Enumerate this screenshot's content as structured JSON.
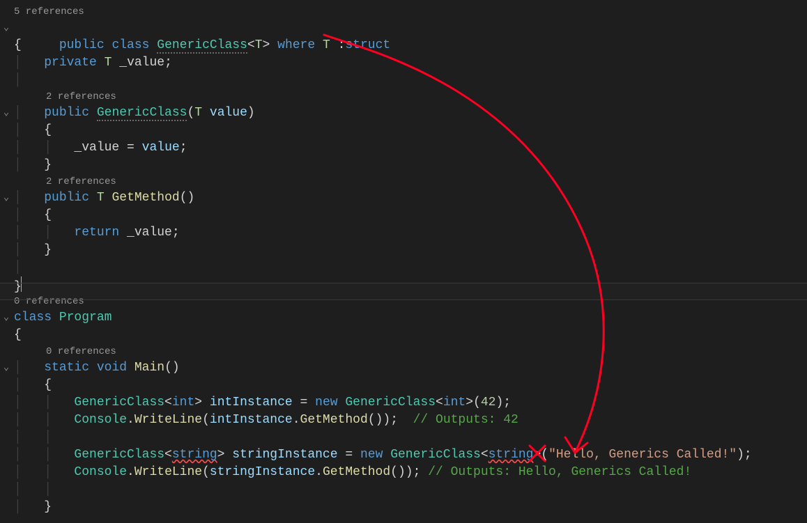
{
  "codelens": {
    "ref5": "5 references",
    "ref2a": "2 references",
    "ref2b": "2 references",
    "ref0a": "0 references",
    "ref0b": "0 references"
  },
  "kw": {
    "public": "public",
    "class": "class",
    "where": "where",
    "struct": "struct",
    "private": "private",
    "return": "return",
    "static": "static",
    "void": "void",
    "new": "new",
    "int": "int",
    "string": "string"
  },
  "type": {
    "GenericClass": "GenericClass",
    "Console": "Console",
    "T": "T"
  },
  "method": {
    "GetMethod": "GetMethod",
    "Main": "Main",
    "WriteLine": "WriteLine"
  },
  "ident": {
    "value_param": "value",
    "intInstance": "intInstance",
    "stringInstance": "stringInstance",
    "Program": "Program"
  },
  "field": {
    "_value": "_value"
  },
  "literal": {
    "n42": "42",
    "hello": "\"Hello, Generics Called!\""
  },
  "comment": {
    "out42": "// Outputs: 42",
    "outHello": "// Outputs: Hello, Generics Called!"
  },
  "punct": {
    "open_brace": "{",
    "close_brace": "}",
    "open_paren": "(",
    "close_paren": ")",
    "open_angle": "<",
    "close_angle": ">",
    "semicolon": ";",
    "dot": ".",
    "eq": "=",
    "colon": ":",
    "sp": " ",
    "caret": ""
  },
  "icons": {
    "chevron_down": "⌄"
  },
  "colors": {
    "annotation_stroke": "#ff0022"
  }
}
